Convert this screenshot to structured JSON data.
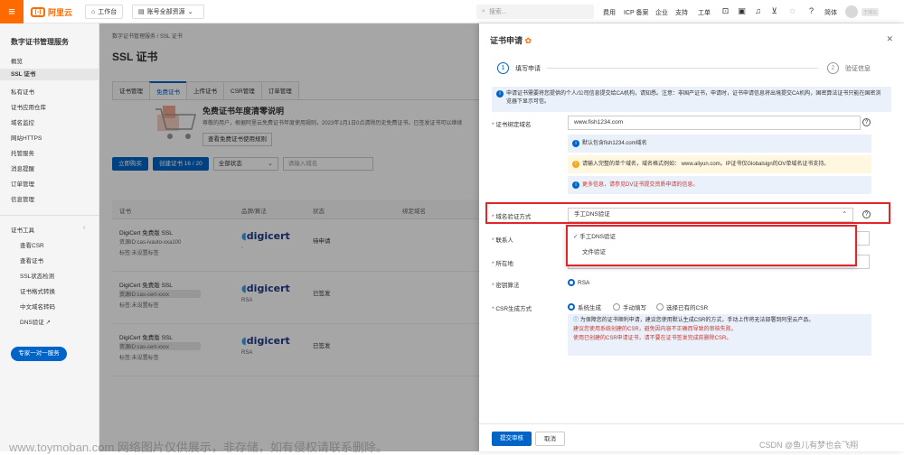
{
  "topbar": {
    "logo_text": "阿里云",
    "workbench": "工作台",
    "account": "账号全部资源",
    "search_placeholder": "搜索...",
    "nav": [
      "费用",
      "ICP 备案",
      "企业",
      "支持",
      "工单"
    ],
    "lang": "简体",
    "user": "王瑞马"
  },
  "sidebar": {
    "title": "数字证书管理服务",
    "items": [
      "概览",
      "SSL 证书",
      "私有证书",
      "证书应用仓库",
      "域名监控",
      "网站HTTPS",
      "托管服务",
      "消息提醒",
      "订单管理",
      "信息管理"
    ],
    "tools_title": "证书工具",
    "tools": [
      "查看CSR",
      "查看证书",
      "SSL状态检测",
      "证书格式转换",
      "中文域名转码",
      "DNS验证 ↗"
    ],
    "service_btn": "专家一对一服务"
  },
  "main": {
    "crumb": "数字证书管理服务 / SSL 证书",
    "title": "SSL 证书",
    "tabs": [
      "证书管理",
      "免费证书",
      "上传证书",
      "CSR管理",
      "订单管理"
    ],
    "promo_title": "免费证书年度清零说明",
    "promo_desc": "尊敬的用户，根据阿里云免费证书年度使用规则，2023年1月1日0点清除历史免费证书。已签发证书可以继续",
    "promo_btn": "查看免费证书使用规则",
    "toolbar": {
      "buy": "立即购买",
      "create": "创建证书 16 / 20",
      "status": "全部状态",
      "search_placeholder": "请输入域名"
    },
    "columns": [
      "证书",
      "品牌/算法",
      "状态",
      "绑定域名"
    ],
    "rows": [
      {
        "name": "DigiCert 免费版 SSL",
        "id": "资源ID:cas-ivauto-xxa100",
        "tag": "标签:未设置标签",
        "algo": "-",
        "status": "待申请"
      },
      {
        "name": "DigiCert 免费版 SSL",
        "id": "资源ID:cas-cert-xxxx",
        "tag": "标签:未设置标签",
        "algo": "RSA",
        "status": "已签发"
      },
      {
        "name": "DigiCert 免费版 SSL",
        "id": "资源ID:cas-cert-xxxx",
        "tag": "标签:未设置标签",
        "algo": "RSA",
        "status": "已签发"
      }
    ],
    "brand": "digicert"
  },
  "drawer": {
    "title": "证书申请",
    "step1": "填写申请",
    "step2": "验证信息",
    "notice": "申请证书需要将您提供的个人/公司信息提交给CA机构，请知悉。注意：非国产证书，申请时，证书申请信息将出境提交CA机构，国密算法证书只能在国密浏览器下显示可信。",
    "label_domain": "证书绑定域名",
    "domain_value": "www.fish1234.com",
    "info_domain": "默认包含fish1234.com域名",
    "warn_domain": "请输入完整的单个域名，域名格式例如： www.aliyun.com。IP证书仅Globalsign的OV单域名证书支持。",
    "info_dv": "更多信息，请参见DV证书提交资质申请的信息。",
    "label_verify": "域名验证方式",
    "verify_value": "手工DNS验证",
    "verify_options": [
      "手工DNS验证",
      "文件验证"
    ],
    "label_contact": "联系人",
    "label_location": "所在地",
    "location_value": "中国大陆 / 北京市",
    "label_algo": "密钥算法",
    "algo_value": "RSA",
    "label_csr": "CSR生成方式",
    "csr_options": [
      "系统生成",
      "手动填写",
      "选择已有的CSR"
    ],
    "csr_info": "为保障您的证书顺利申请，建议您使用默认生成CSR的方式，手动上传将无法部署到阿里云产品。",
    "csr_warn1": "建议您使用系统创建的CSR，避免因内容不正确而导致的审核失败。",
    "csr_warn2": "使用已创建的CSR申请证书，请不要在证书签发完成前删除CSR。",
    "submit": "提交审核",
    "cancel": "取消"
  },
  "watermark": "www.toymoban.com 网络图片仅供展示，非存储，如有侵权请联系删除。",
  "watermark2": "CSDN @鱼儿有梦也会飞翔"
}
